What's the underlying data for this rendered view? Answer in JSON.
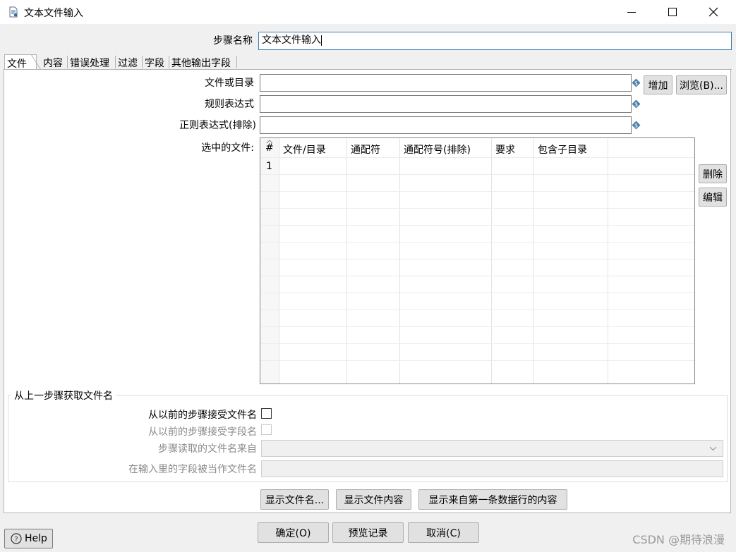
{
  "window": {
    "title": "文本文件输入",
    "minimize_glyph": "—",
    "maximize_glyph": "☐",
    "close_glyph": "✕"
  },
  "step_name": {
    "label": "步骤名称",
    "value": "文本文件输入"
  },
  "tabs": [
    {
      "label": "文件",
      "active": true
    },
    {
      "label": "内容"
    },
    {
      "label": "错误处理"
    },
    {
      "label": "过滤"
    },
    {
      "label": "字段"
    },
    {
      "label": "其他输出字段"
    }
  ],
  "file_tab": {
    "file_or_dir": {
      "label": "文件或目录",
      "value": ""
    },
    "regex": {
      "label": "规则表达式",
      "value": ""
    },
    "regex_exclude": {
      "label": "正则表达式(排除)",
      "value": ""
    },
    "add_button": "增加",
    "browse_button": "浏览(B)...",
    "selected_files_label": "选中的文件:",
    "grid": {
      "columns": [
        "#",
        "文件/目录",
        "通配符",
        "通配符号(排除)",
        "要求",
        "包含子目录"
      ],
      "rows": [
        [
          "1",
          "",
          "",
          "",
          "",
          ""
        ]
      ]
    },
    "delete_button": "删除",
    "edit_button": "编辑"
  },
  "prev_step_group": {
    "title": "从上一步骤获取文件名",
    "accept_filenames_label": "从以前的步骤接受文件名",
    "accept_fieldnames_label": "从以前的步骤接受字段名",
    "step_source_label": "步骤读取的文件名来自",
    "field_as_filename_label": "在输入里的字段被当作文件名"
  },
  "bottom_buttons": {
    "show_filenames": "显示文件名...",
    "show_file_content": "显示文件内容",
    "show_first_row_content": "显示来自第一条数据行的内容"
  },
  "footer": {
    "help": "Help",
    "ok": "确定(O)",
    "preview": "预览记录",
    "cancel": "取消(C)"
  },
  "watermark": "CSDN @期待浪漫"
}
